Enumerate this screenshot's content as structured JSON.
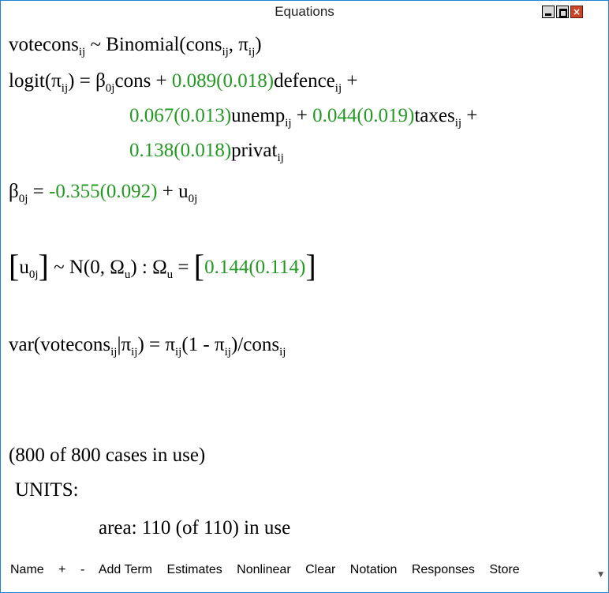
{
  "window": {
    "title": "Equations"
  },
  "eq": {
    "l1": {
      "a": "votecons",
      "s1": "ij",
      "b": " ~ Binomial(cons",
      "s2": "ij",
      "c": ", π",
      "s3": "ij",
      "d": ")"
    },
    "l2": {
      "a": "logit(π",
      "s1": "ij",
      "b": ") = β",
      "s2": "0j",
      "c": "cons + ",
      "g1": "0.089(0.018)",
      "d": "defence",
      "s3": "ij",
      "e": " +"
    },
    "l3": {
      "g1": "0.067(0.013)",
      "a": "unemp",
      "s1": "ij",
      "b": " + ",
      "g2": "0.044(0.019)",
      "c": "taxes",
      "s2": "ij",
      "d": " +"
    },
    "l4": {
      "g1": "0.138(0.018)",
      "a": "privat",
      "s1": "ij"
    },
    "l5": {
      "a": "β",
      "s1": "0j",
      "b": " = ",
      "g1": "-0.355(0.092)",
      "c": " + u",
      "s2": "0j"
    },
    "l6": {
      "lb": "[",
      "a": "u",
      "s1": "0j",
      "rb": "]",
      "b": "  ~ N(0,  Ω",
      "s2": "u",
      "c": ")  :  Ω",
      "s3": "u",
      "d": " = ",
      "lb2": "[",
      "g1": "0.144(0.114)",
      "rb2": "]"
    },
    "l7": {
      "a": "var(votecons",
      "s1": "ij",
      "b": "|π",
      "s2": "ij",
      "c": ") = π",
      "s3": "ij",
      "d": "(1 - π",
      "s4": "ij",
      "e": ")/cons",
      "s5": "ij"
    },
    "cases": "(800 of 800 cases in use)",
    "units_label": "UNITS:",
    "area": "area: 110 (of 110) in use"
  },
  "toolbar": [
    "Name",
    "+",
    "-",
    "Add Term",
    "Estimates",
    "Nonlinear",
    "Clear",
    "Notation",
    "Responses",
    "Store"
  ]
}
